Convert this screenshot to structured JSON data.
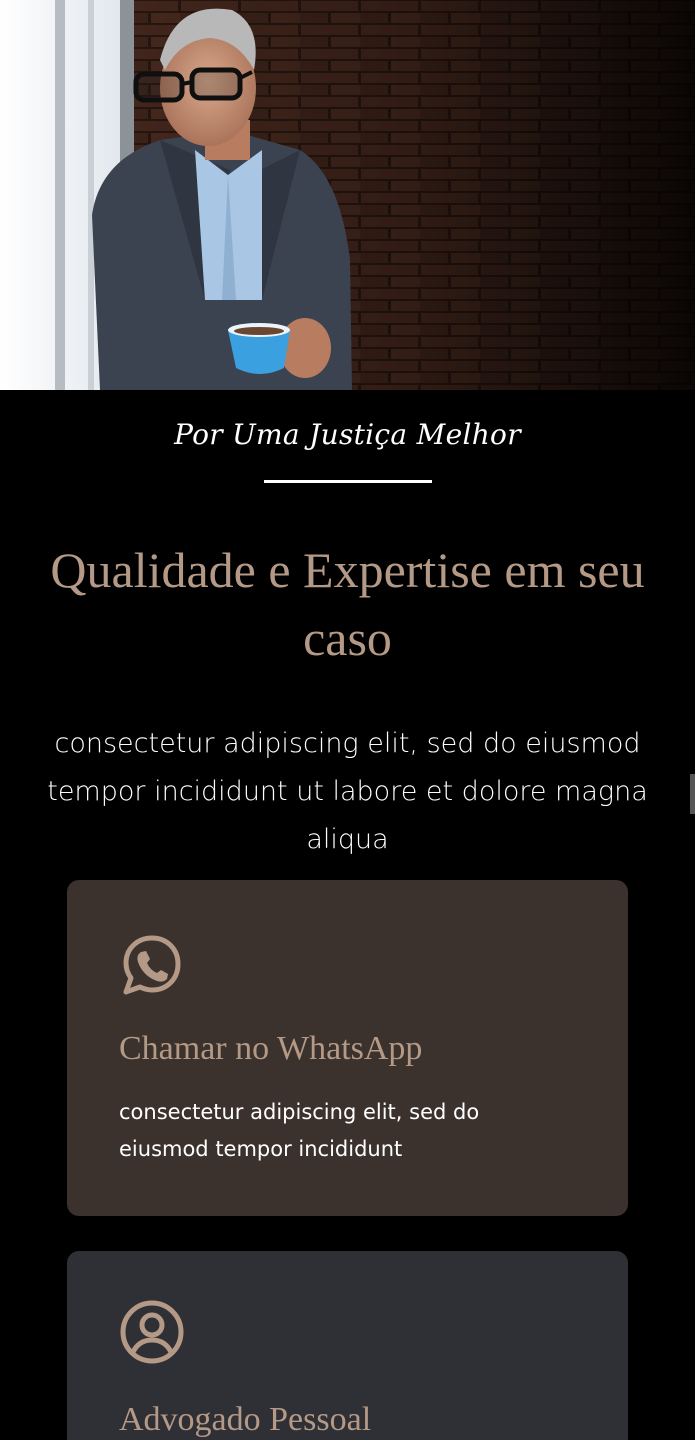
{
  "hero": {
    "image": "portrait-man-with-coffee"
  },
  "tagline": {
    "text": "Por Uma Justiça Melhor"
  },
  "headline": {
    "text": "Qualidade e Expertise em seu caso"
  },
  "intro": {
    "text": "consectetur adipiscing elit, sed do eiusmod tempor incididunt ut labore et dolore magna aliqua"
  },
  "cards": [
    {
      "icon": "whatsapp-icon",
      "title": "Chamar no WhatsApp",
      "text": "consectetur adipiscing elit, sed do eiusmod tempor incididunt"
    },
    {
      "icon": "user-circle-icon",
      "title": "Advogado Pessoal"
    }
  ],
  "colors": {
    "background": "#000000",
    "accent": "#b49a86",
    "card_whatsapp_bg": "#3b322d",
    "card_advogado_bg": "#2f3036",
    "text": "#ffffff"
  }
}
